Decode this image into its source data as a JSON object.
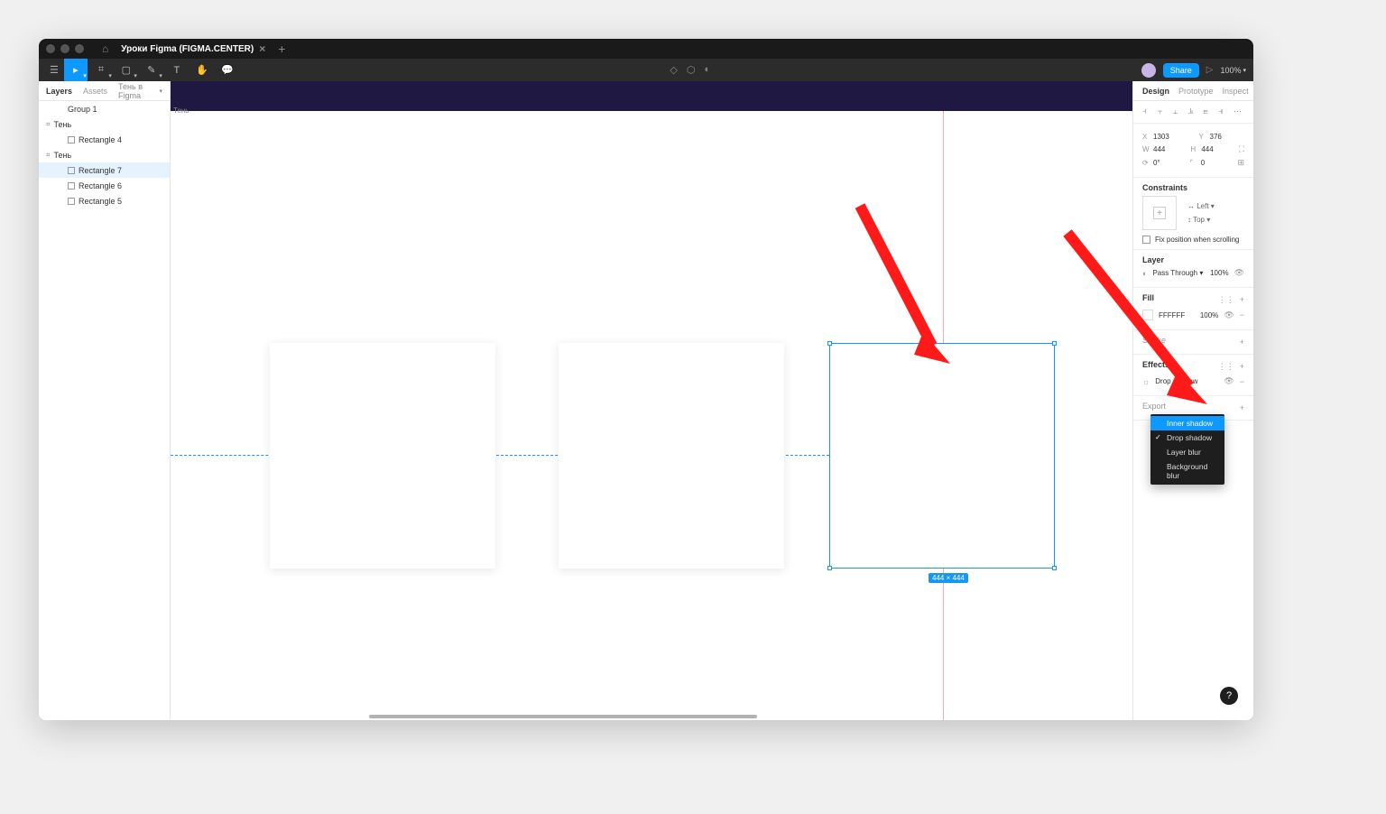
{
  "title_bar": {
    "file_name": "Уроки Figma (FIGMA.CENTER)"
  },
  "toolbar": {
    "share": "Share",
    "zoom": "100%"
  },
  "left_panel": {
    "tab_layers": "Layers",
    "tab_assets": "Assets",
    "page": "Тень в Figma",
    "layers": [
      {
        "name": "Group 1",
        "indent": 1,
        "type": "group"
      },
      {
        "name": "Тень",
        "indent": 0,
        "type": "frame"
      },
      {
        "name": "Rectangle 4",
        "indent": 2,
        "type": "rect"
      },
      {
        "name": "Тень",
        "indent": 0,
        "type": "frame"
      },
      {
        "name": "Rectangle 7",
        "indent": 2,
        "type": "rect",
        "selected": true
      },
      {
        "name": "Rectangle 6",
        "indent": 2,
        "type": "rect"
      },
      {
        "name": "Rectangle 5",
        "indent": 2,
        "type": "rect"
      }
    ]
  },
  "canvas": {
    "frame_label": "Тень",
    "selection_dims": "444 × 444"
  },
  "right_panel": {
    "tab_design": "Design",
    "tab_prototype": "Prototype",
    "tab_inspect": "Inspect",
    "x_label": "X",
    "x_val": "1303",
    "y_label": "Y",
    "y_val": "376",
    "w_label": "W",
    "w_val": "444",
    "h_label": "H",
    "h_val": "444",
    "rot_label": "",
    "rot_val": "0°",
    "corner_val": "0",
    "section_constraints": "Constraints",
    "constraint_h": "Left",
    "constraint_v": "Top",
    "fix_scroll": "Fix position when scrolling",
    "section_layer": "Layer",
    "blend_mode": "Pass Through",
    "layer_opacity": "100%",
    "section_fill": "Fill",
    "fill_hex": "FFFFFF",
    "fill_opacity": "100%",
    "section_stroke": "Stroke",
    "section_effects": "Effects",
    "effect_current": "Drop shadow",
    "section_export": "Export"
  },
  "effect_popup": {
    "items": [
      {
        "label": "Inner shadow",
        "highlighted": true
      },
      {
        "label": "Drop shadow",
        "checked": true
      },
      {
        "label": "Layer blur"
      },
      {
        "label": "Background blur"
      }
    ]
  },
  "help": "?"
}
